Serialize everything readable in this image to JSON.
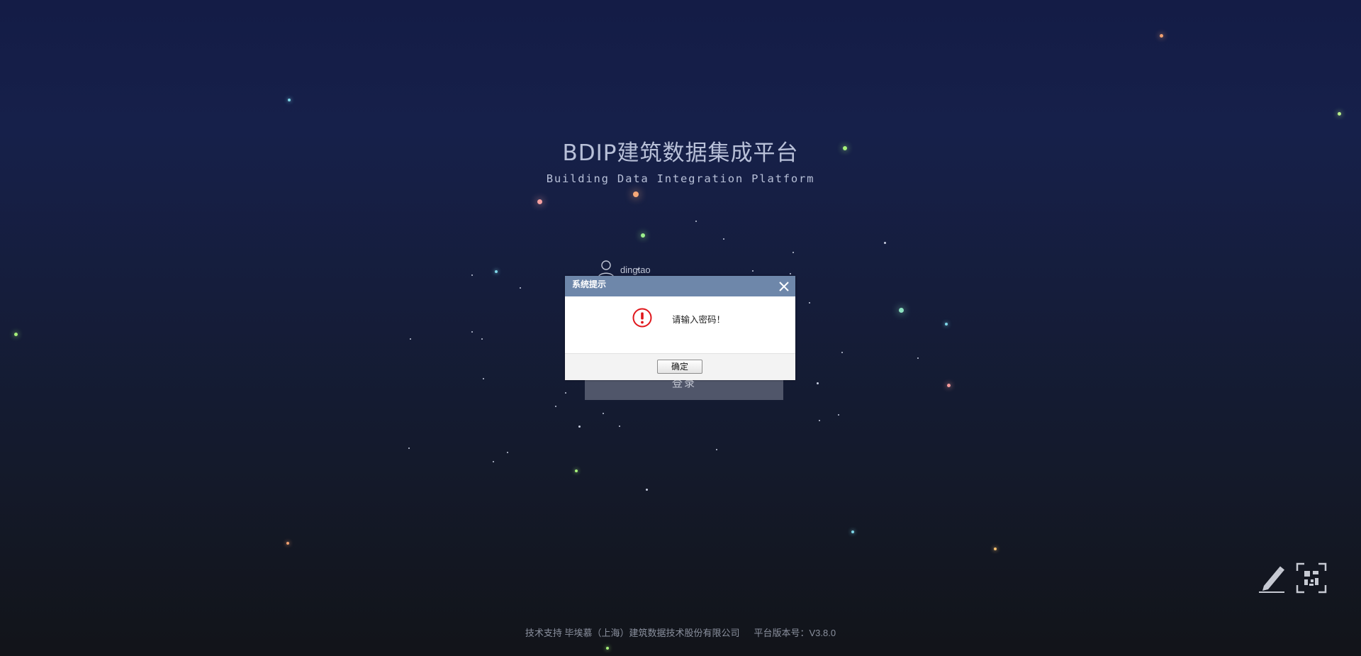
{
  "header": {
    "title": "BDIP建筑数据集成平台",
    "subtitle": "Building Data Integration Platform"
  },
  "login_form": {
    "username": "dingtao",
    "login_button_label": "登录"
  },
  "dialog": {
    "title": "系统提示",
    "message": "请输入密码！",
    "ok_label": "确定"
  },
  "tools": {
    "icons": [
      "pen-icon",
      "qr-code-scan-icon"
    ]
  },
  "footer": {
    "support_text": "技术支持 毕埃慕（上海）建筑数据技术股份有限公司",
    "version_text": "平台版本号：V3.8.0"
  },
  "colors": {
    "background_top": "#141c46",
    "background_bottom": "#121419",
    "dialog_header": "#6e87aa",
    "alert_red": "#e0161b"
  }
}
